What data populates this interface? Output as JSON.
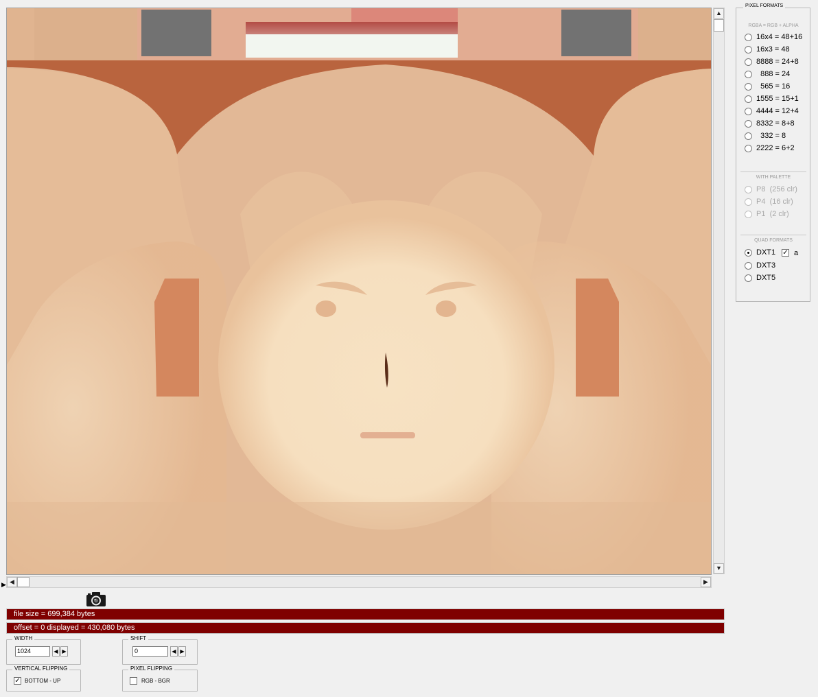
{
  "status": {
    "file_size": "file size = 699,384 bytes",
    "offset_line": "offset = 0   displayed = 430,080 bytes"
  },
  "width_box": {
    "legend": "WIDTH",
    "value": "1024",
    "dec_icon": "◀",
    "inc_icon": "▶"
  },
  "shift_box": {
    "legend": "SHIFT",
    "value": "0",
    "dec_icon": "◀",
    "inc_icon": "▶"
  },
  "vertical_flipping": {
    "legend": "VERTICAL FLIPPING",
    "label": "BOTTOM - UP",
    "checked_mark": "✓"
  },
  "pixel_flipping": {
    "legend": "PIXEL FLIPPING",
    "label": "RGB  -  BGR",
    "checked_mark": ""
  },
  "formats_panel": {
    "legend": "PIXEL FORMATS",
    "rgba_subhead": "RGBA = RGB + ALPHA",
    "pixel_formats": [
      {
        "label": "16x4 = 48+16"
      },
      {
        "label": "16x3 = 48"
      },
      {
        "label": "8888 = 24+8"
      },
      {
        "label": "  888 = 24"
      },
      {
        "label": "  565 = 16"
      },
      {
        "label": "1555 = 15+1"
      },
      {
        "label": "4444 = 12+4"
      },
      {
        "label": "8332 = 8+8"
      },
      {
        "label": "  332 = 8"
      },
      {
        "label": "2222 = 6+2"
      }
    ],
    "palette_subhead": "WITH PALETTE",
    "palette_formats": [
      {
        "label": "P8  (256 clr)"
      },
      {
        "label": "P4  (16 clr)"
      },
      {
        "label": "P1  (2 clr)"
      }
    ],
    "quad_subhead": "QUAD FORMATS",
    "quad_formats": [
      {
        "label": "DXT1"
      },
      {
        "label": "DXT3"
      },
      {
        "label": "DXT5"
      }
    ],
    "alpha_checkbox_label": "a",
    "alpha_checked_mark": "✓",
    "selected_format": "DXT1"
  },
  "scroll": {
    "up_icon": "▲",
    "down_icon": "▼",
    "left_icon": "◀",
    "right_icon": "▶"
  },
  "icons": {
    "camera": "camera-icon",
    "marker": "▶"
  },
  "colors": {
    "status_bar": "#7f0000",
    "skin_base": "#e2b896",
    "hair_edge": "#b9643e"
  }
}
